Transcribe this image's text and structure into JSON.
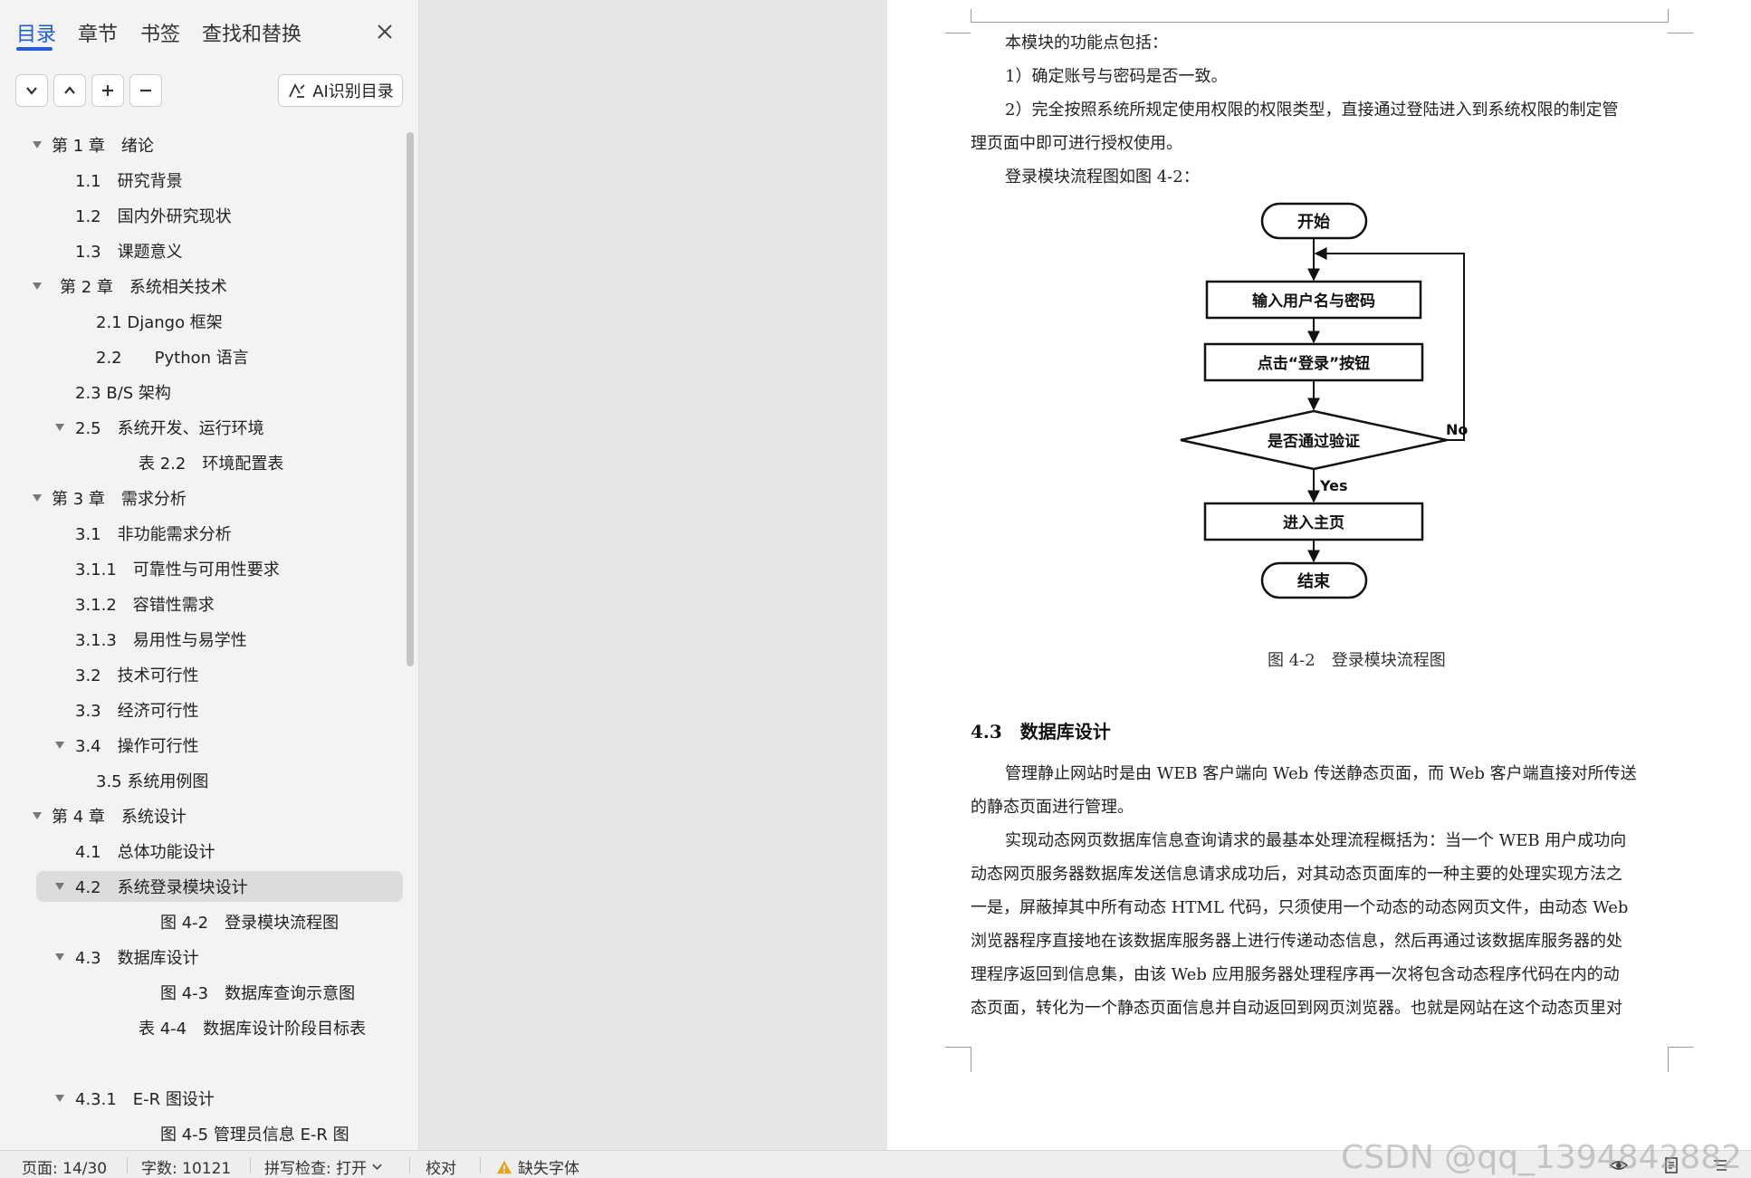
{
  "nav": {
    "tabs": [
      {
        "label": "目录"
      },
      {
        "label": "章节"
      },
      {
        "label": "书签"
      },
      {
        "label": "查找和替换"
      }
    ],
    "ai_button_label": "AI识别目录",
    "toc": [
      {
        "label": "第 1 章　绪论"
      },
      {
        "label": "1.1　研究背景"
      },
      {
        "label": "1.2　国内外研究现状"
      },
      {
        "label": "1.3　课题意义"
      },
      {
        "label": "第 2 章　系统相关技术"
      },
      {
        "label": "2.1 Django 框架"
      },
      {
        "label": "2.2　　Python 语言"
      },
      {
        "label": "2.3 B/S 架构"
      },
      {
        "label": "2.5　系统开发、运行环境"
      },
      {
        "label": "表 2.2　环境配置表"
      },
      {
        "label": "第 3 章　需求分析"
      },
      {
        "label": "3.1　非功能需求分析"
      },
      {
        "label": "3.1.1　可靠性与可用性要求"
      },
      {
        "label": "3.1.2　容错性需求"
      },
      {
        "label": "3.1.3　易用性与易学性"
      },
      {
        "label": "3.2　技术可行性"
      },
      {
        "label": "3.3　经济可行性"
      },
      {
        "label": "3.4　操作可行性"
      },
      {
        "label": "3.5 系统用例图"
      },
      {
        "label": "第 4 章　系统设计"
      },
      {
        "label": "4.1　总体功能设计"
      },
      {
        "label": "4.2　系统登录模块设计"
      },
      {
        "label": "图 4-2　登录模块流程图"
      },
      {
        "label": "4.3　数据库设计"
      },
      {
        "label": "图 4-3　数据库查询示意图"
      },
      {
        "label": "表 4-4　数据库设计阶段目标表"
      },
      {
        "label": "4.3.1　E-R 图设计"
      },
      {
        "label": "图 4-5 管理员信息 E-R 图"
      }
    ]
  },
  "document": {
    "paragraphs": [
      "本模块的功能点包括：",
      "1）确定账号与密码是否一致。",
      "2）完全按照系统所规定使用权限的权限类型，直接通过登陆进入到系统权限的制定管",
      "理页面中即可进行授权使用。",
      "登录模块流程图如图 4-2："
    ],
    "flowchart": {
      "start": "开始",
      "input": "输入用户名与密码",
      "click": "点击“登录”按钮",
      "decision": "是否通过验证",
      "no": "No",
      "yes": "Yes",
      "home": "进入主页",
      "end": "结束"
    },
    "caption": "图 4-2　登录模块流程图",
    "section_heading": "4.3　数据库设计",
    "body": [
      "管理静止网站时是由 WEB 客户端向 Web 传送静态页面，而 Web 客户端直接对所传送",
      "的静态页面进行管理。",
      "实现动态网页数据库信息查询请求的最基本处理流程概括为：当一个 WEB 用户成功向",
      "动态网页服务器数据库发送信息请求成功后，对其动态页面库的一种主要的处理实现方法之",
      "一是，屏蔽掉其中所有动态 HTML 代码，只须使用一个动态的动态网页文件，由动态 Web",
      "浏览器程序直接地在该数据库服务器上进行传递动态信息，然后再通过该数据库服务器的处",
      "理程序返回到信息集，由该 Web 应用服务器处理程序再一次将包含动态程序代码在内的动",
      "态页面，转化为一个静态页面信息并自动返回到网页浏览器。也就是网站在这个动态页里对"
    ]
  },
  "status": {
    "page": "页面: 14/30",
    "words": "字数: 10121",
    "spell": "拼写检查: 打开",
    "proof": "校对",
    "missing_font": "缺失字体"
  },
  "watermark": "CSDN @qq_1394842882",
  "colors": {
    "accent": "#1e5fd6",
    "pane_bg": "#f3f3f3",
    "selected_bg": "#dcdcdc",
    "warning": "#e8a317"
  }
}
